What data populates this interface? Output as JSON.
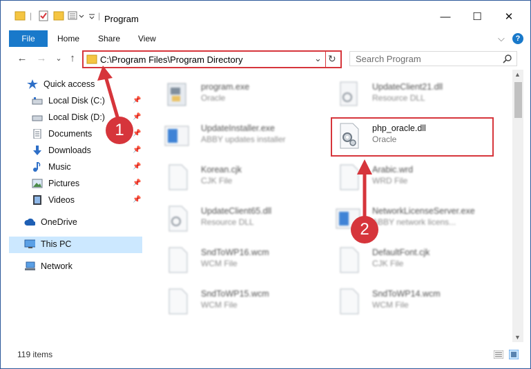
{
  "window": {
    "title": "Program",
    "minimize": "—",
    "maximize": "☐",
    "close": "✕"
  },
  "ribbon": {
    "file": "File",
    "tabs": [
      "Home",
      "Share",
      "View"
    ],
    "help": "?",
    "expand": "⌵"
  },
  "nav": {
    "back": "←",
    "forward": "→",
    "recent": "⌄",
    "up": "↑",
    "refresh": "↻",
    "dropdown": "⌄"
  },
  "address": {
    "path": "C:\\Program Files\\Program Directory"
  },
  "search": {
    "placeholder": "Search Program"
  },
  "sidebar": {
    "items": [
      {
        "label": "Quick access",
        "icon": "star-icon"
      },
      {
        "label": "Local Disk (C:)",
        "icon": "drive-icon",
        "pinned": true
      },
      {
        "label": "Local Disk (D:)",
        "icon": "drive-icon",
        "pinned": true
      },
      {
        "label": "Documents",
        "icon": "documents-icon",
        "pinned": true
      },
      {
        "label": "Downloads",
        "icon": "downloads-icon",
        "pinned": true
      },
      {
        "label": "Music",
        "icon": "music-icon",
        "pinned": true
      },
      {
        "label": "Pictures",
        "icon": "pictures-icon",
        "pinned": true
      },
      {
        "label": "Videos",
        "icon": "videos-icon",
        "pinned": true
      },
      {
        "label": "OneDrive",
        "icon": "cloud-icon"
      },
      {
        "label": "This PC",
        "icon": "computer-icon",
        "selected": true
      },
      {
        "label": "Network",
        "icon": "network-icon"
      }
    ]
  },
  "files": [
    {
      "name": "program.exe",
      "type": "Oracle"
    },
    {
      "name": "UpdateClient21.dll",
      "type": "Resource DLL"
    },
    {
      "name": "UpdateInstaller.exe",
      "type": "ABBY updates installer"
    },
    {
      "name": "php_oracle.dll",
      "type": "Oracle"
    },
    {
      "name": "Korean.cjk",
      "type": "CJK File"
    },
    {
      "name": "Arabic.wrd",
      "type": "WRD File"
    },
    {
      "name": "UpdateClient65.dll",
      "type": "Resource DLL"
    },
    {
      "name": "NetworkLicenseServer.exe",
      "type": "ABBY network licens..."
    },
    {
      "name": "SndToWP16.wcm",
      "type": "WCM File"
    },
    {
      "name": "DefaultFont.cjk",
      "type": "CJK File"
    },
    {
      "name": "SndToWP15.wcm",
      "type": "WCM File"
    },
    {
      "name": "SndToWP14.wcm",
      "type": "WCM File"
    }
  ],
  "status": {
    "items": "119 items"
  },
  "steps": [
    "1",
    "2"
  ],
  "colors": {
    "accent": "#1979ca",
    "highlight": "#d6353b",
    "selected": "#cce8ff"
  }
}
